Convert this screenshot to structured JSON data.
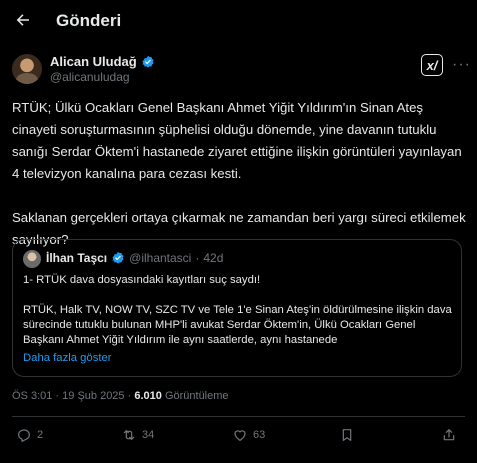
{
  "header": {
    "title": "Gönderi",
    "back_icon": "arrow-left-icon"
  },
  "author": {
    "name": "Alican Uludağ",
    "handle": "@alicanuludag",
    "verified_color": "#1d9bf0"
  },
  "tweet": {
    "text": "RTÜK; Ülkü Ocakları Genel Başkanı Ahmet Yiğit Yıldırım'ın Sinan Ateş cinayeti soruşturmasının şüphelisi olduğu dönemde, yine davanın tutuklu sanığı Serdar Öktem'i hastanede ziyaret ettiğine ilişkin görüntüleri yayınlayan 4 televizyon kanalına para cezası kesti.\n\nSaklanan gerçekleri ortaya çıkarmak ne zamandan beri yargı süreci etkilemek sayılıyor?"
  },
  "quote": {
    "name": "İlhan Taşcı",
    "handle": "@ilhantasci",
    "separator": "·",
    "age": "42d",
    "text": "1- RTÜK dava dosyasındaki kayıtları suç saydı!\n\nRTÜK, Halk TV, NOW TV, SZC TV ve Tele 1'e Sinan Ateş'in öldürülmesine ilişkin dava sürecinde tutuklu bulunan MHP'li avukat Serdar Öktem'in, Ülkü Ocakları Genel Başkanı Ahmet Yiğit Yıldırım ile aynı saatlerde, aynı hastanede",
    "show_more": "Daha fazla göster"
  },
  "meta": {
    "time": "ÖS 3:01",
    "dot": "·",
    "date": "19 Şub 2025",
    "views_count": "6.010",
    "views_label": "Görüntüleme"
  },
  "actions": {
    "replies": "2",
    "reposts": "34",
    "likes": "63"
  },
  "colors": {
    "background": "#000000",
    "text": "#e7e9ea",
    "muted": "#71767b",
    "accent": "#1d9bf0",
    "border": "#2f3336"
  }
}
